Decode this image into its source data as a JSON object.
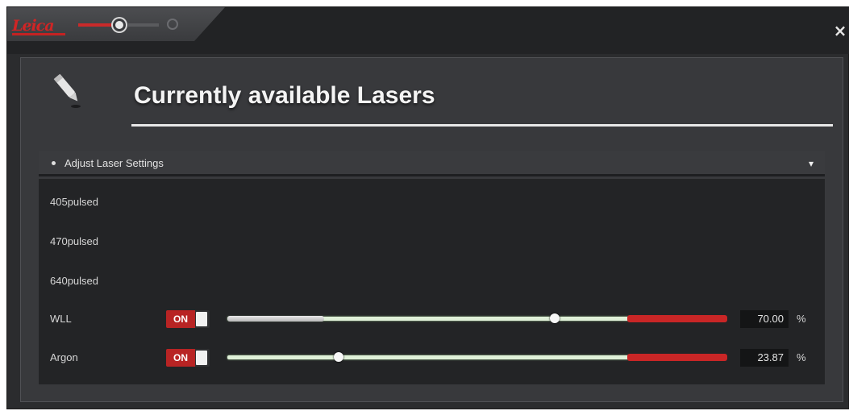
{
  "window": {
    "logo_text": "Leica",
    "close_symbol": "×"
  },
  "steps": [
    {
      "label": "step-1",
      "state": "complete"
    },
    {
      "label": "step-2",
      "state": "current"
    },
    {
      "label": "step-3",
      "state": "pending"
    }
  ],
  "page": {
    "title": "Currently available Lasers",
    "icon": "pencil-icon"
  },
  "section": {
    "title": "Adjust Laser Settings",
    "pin_symbol": "▾"
  },
  "lasers": [
    {
      "name": "405pulsed"
    },
    {
      "name": "470pulsed"
    },
    {
      "name": "640pulsed"
    },
    {
      "name": "WLL",
      "state": "ON",
      "value": "70.00",
      "unit": "%",
      "level": 0.7
    },
    {
      "name": "Argon",
      "state": "ON",
      "value": "23.87",
      "unit": "%",
      "level": 0.2387
    }
  ],
  "colors": {
    "accent_red": "#c92626",
    "track_green": "#dff0d8",
    "background": "#2b2c2e"
  }
}
